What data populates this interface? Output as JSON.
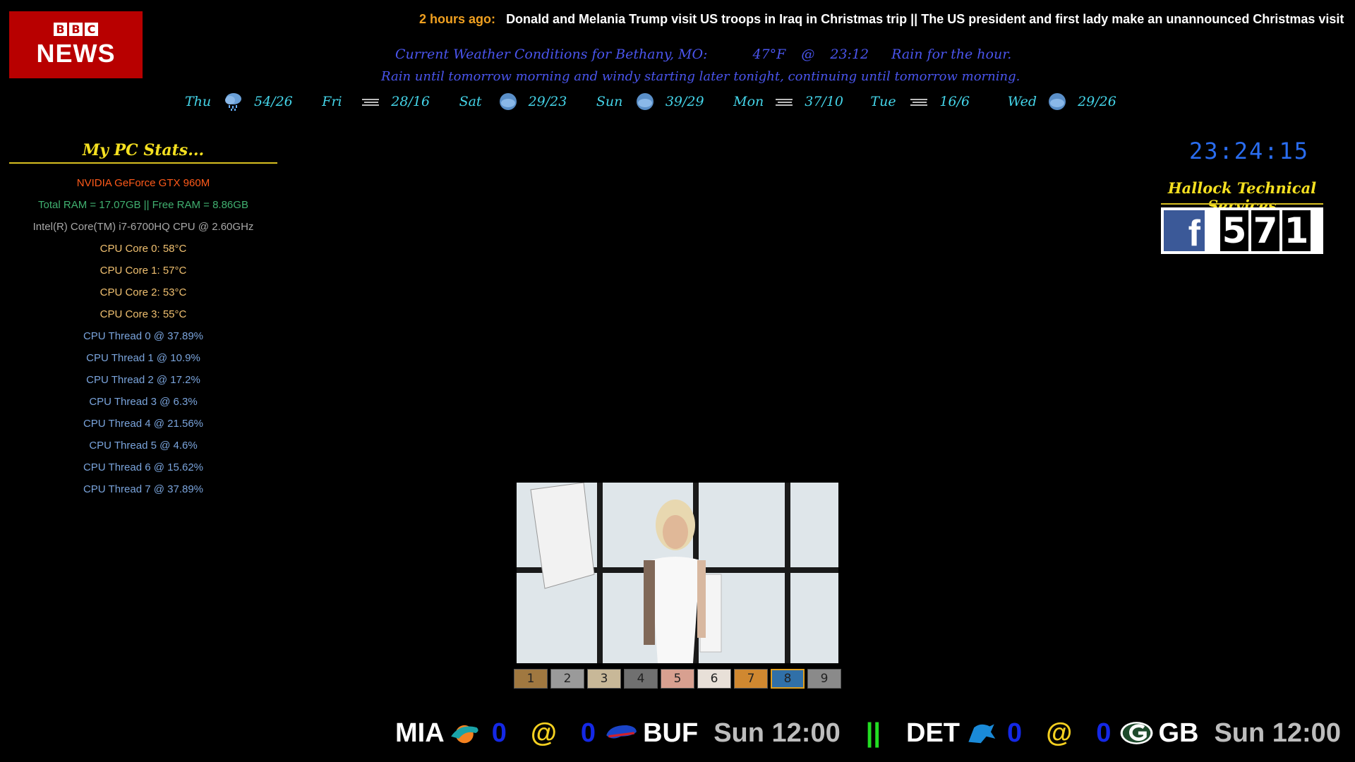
{
  "bbc": {
    "blocks": [
      "B",
      "B",
      "C"
    ],
    "news": "NEWS"
  },
  "ticker": {
    "age": "2 hours ago:",
    "text": "Donald and Melania Trump visit US troops in Iraq in Christmas trip  ||  The US president and first lady make an unannounced Christmas visit to US service personne"
  },
  "weather": {
    "current_label": "Current Weather Conditions for Bethany, MO:",
    "current_icon": "cloud-rain-icon",
    "temp": "47°F",
    "at": "@",
    "time": "23:12",
    "summary": "Rain for the hour.",
    "detail": "Rain until tomorrow morning and windy starting later tonight, continuing until tomorrow morning.",
    "forecast": [
      {
        "day": "Thu",
        "icon": "cloud-rain-icon",
        "temps": "54/26"
      },
      {
        "day": "Fri",
        "icon": "fog-icon",
        "temps": "28/16"
      },
      {
        "day": "Sat",
        "icon": "cloud-icon",
        "temps": "29/23"
      },
      {
        "day": "Sun",
        "icon": "cloud-icon",
        "temps": "39/29"
      },
      {
        "day": "Mon",
        "icon": "fog-icon",
        "temps": "37/10"
      },
      {
        "day": "Tue",
        "icon": "fog-icon",
        "temps": "16/6"
      },
      {
        "day": "Wed",
        "icon": "cloud-icon",
        "temps": "29/26"
      }
    ]
  },
  "stats": {
    "title": "My PC Stats...",
    "gpu": "NVIDIA GeForce GTX 960M",
    "ram": "Total RAM = 17.07GB  ||  Free RAM = 8.86GB",
    "cpu": "Intel(R) Core(TM) i7-6700HQ CPU @ 2.60GHz",
    "cores": [
      "CPU Core 0:   58°C",
      "CPU Core 1:   57°C",
      "CPU Core 2:   53°C",
      "CPU Core 3:   55°C"
    ],
    "threads": [
      "CPU Thread 0   @   37.89%",
      "CPU Thread 1   @   10.9%",
      "CPU Thread 2   @   17.2%",
      "CPU Thread 3   @   6.3%",
      "CPU Thread 4   @   21.56%",
      "CPU Thread 5   @   4.6%",
      "CPU Thread 6   @   15.62%",
      "CPU Thread 7   @   37.89%"
    ]
  },
  "clock": {
    "time": "23:24:15"
  },
  "hallock": {
    "title": "Hallock Technical Services",
    "fb_letter": "f",
    "fb_count": [
      "5",
      "7",
      "1"
    ]
  },
  "filmstrip": {
    "items": [
      "1",
      "2",
      "3",
      "4",
      "5",
      "6",
      "7",
      "8",
      "9"
    ],
    "active": "8"
  },
  "scores": [
    {
      "away": "MIA",
      "away_score": "0",
      "at": "@",
      "home_score": "0",
      "home": "BUF",
      "time": "Sun 12:00"
    },
    {
      "away": "DET",
      "away_score": "0",
      "at": "@",
      "home_score": "0",
      "home": "GB",
      "time": "Sun 12:00"
    }
  ],
  "scores_separator": "||",
  "colors": {
    "bbc_red": "#b80000",
    "weather_blue": "#4a55ee",
    "forecast_cyan": "#44d4e8",
    "title_yellow": "#f5e020",
    "clock_blue": "#2a6df0",
    "score_blue": "#1428e6",
    "separator_green": "#22dd22"
  }
}
